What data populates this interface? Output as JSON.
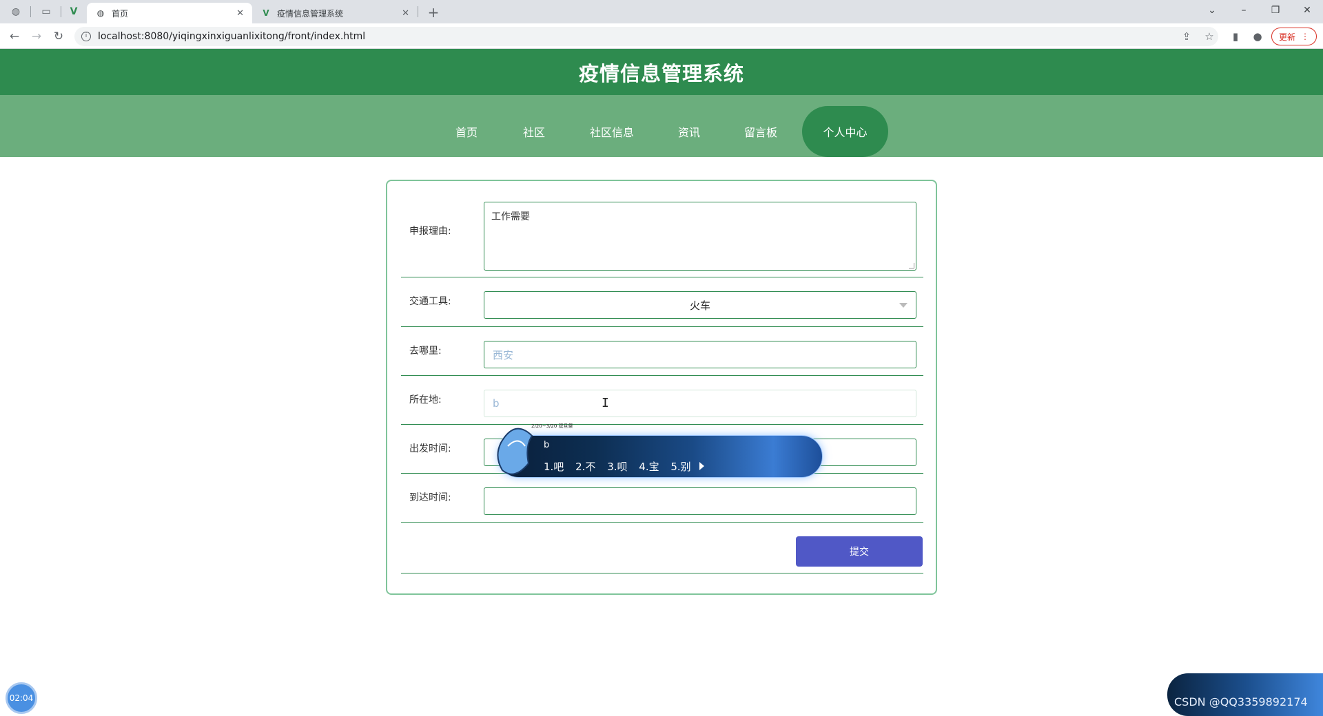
{
  "browser": {
    "tabs": [
      {
        "title": "首页",
        "active": true
      },
      {
        "title": "疫情信息管理系统",
        "active": false
      }
    ],
    "url": "localhost:8080/yiqingxinxiguanlixitong/front/index.html",
    "update_label": "更新"
  },
  "app": {
    "title": "疫情信息管理系统",
    "nav": [
      {
        "label": "首页",
        "active": false
      },
      {
        "label": "社区",
        "active": false
      },
      {
        "label": "社区信息",
        "active": false
      },
      {
        "label": "资讯",
        "active": false
      },
      {
        "label": "留言板",
        "active": false
      },
      {
        "label": "个人中心",
        "active": true
      }
    ]
  },
  "form": {
    "reason": {
      "label": "申报理由:",
      "value": "工作需要"
    },
    "transport": {
      "label": "交通工具:",
      "value": "火车"
    },
    "destination": {
      "label": "去哪里:",
      "value": "西安"
    },
    "location": {
      "label": "所在地:",
      "value": "b"
    },
    "depart_time": {
      "label": "出发时间:",
      "value": ""
    },
    "arrive_time": {
      "label": "到达时间:",
      "value": ""
    },
    "submit_label": "提交"
  },
  "ime": {
    "composition": "b",
    "banner_text": "2/20~3/20 双旦祭",
    "candidates": [
      "1.吧",
      "2.不",
      "3.呗",
      "4.宝",
      "5.别"
    ]
  },
  "timer": "02:04",
  "watermark": "CSDN @QQ3359892174",
  "colors": {
    "header": "#2e8b4f",
    "nav": "#6bae7d",
    "submit": "#5058c6"
  }
}
